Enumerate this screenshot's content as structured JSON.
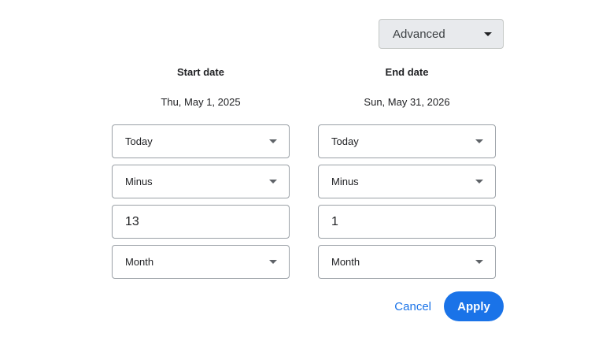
{
  "mode": {
    "selected": "Advanced",
    "icon": "caret-down-icon"
  },
  "start": {
    "title": "Start date",
    "date": "Thu, May 1, 2025",
    "anchor": "Today",
    "operation": "Minus",
    "amount": "13",
    "unit": "Month"
  },
  "end": {
    "title": "End date",
    "date": "Sun, May 31, 2026",
    "anchor": "Today",
    "operation": "Minus",
    "amount": "1",
    "unit": "Month"
  },
  "actions": {
    "cancel_label": "Cancel",
    "apply_label": "Apply"
  },
  "colors": {
    "accent": "#1a73e8",
    "select_bg": "#e8eaed",
    "border": "#9aa0a6"
  }
}
